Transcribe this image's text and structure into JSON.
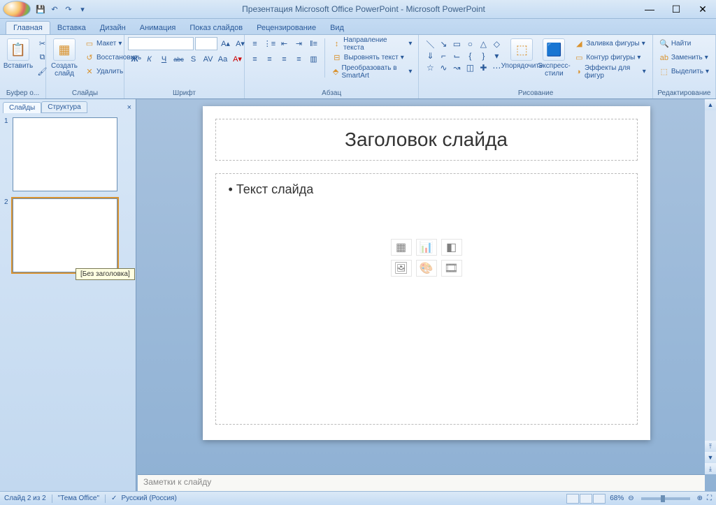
{
  "title": "Презентация Microsoft Office PowerPoint - Microsoft PowerPoint",
  "ribbon_tabs": [
    "Главная",
    "Вставка",
    "Дизайн",
    "Анимация",
    "Показ слайдов",
    "Рецензирование",
    "Вид"
  ],
  "ribbon": {
    "clipboard": {
      "paste": "Вставить",
      "label": "Буфер о..."
    },
    "slides": {
      "new": "Создать\nслайд",
      "layout": "Макет",
      "restore": "Восстановить",
      "delete": "Удалить",
      "label": "Слайды"
    },
    "font": {
      "label": "Шрифт",
      "bold": "Ж",
      "italic": "К",
      "underline": "Ч",
      "strike": "abc",
      "shadow": "S",
      "spacing": "AV",
      "case": "Aa",
      "grow": "A",
      "shrink": "A"
    },
    "paragraph": {
      "label": "Абзац",
      "text_dir": "Направление текста",
      "align_text": "Выровнять текст",
      "smartart": "Преобразовать в SmartArt"
    },
    "drawing": {
      "label": "Рисование",
      "arrange": "Упорядочить",
      "styles": "Экспресс-стили",
      "fill": "Заливка фигуры",
      "outline": "Контур фигуры",
      "effects": "Эффекты для фигур"
    },
    "editing": {
      "label": "Редактирование",
      "find": "Найти",
      "replace": "Заменить",
      "select": "Выделить"
    }
  },
  "panel": {
    "tab_slides": "Слайды",
    "tab_outline": "Структура",
    "tooltip": "[Без заголовка]",
    "thumbs": [
      "1",
      "2"
    ]
  },
  "slide": {
    "title": "Заголовок слайда",
    "body": "Текст слайда"
  },
  "notes": {
    "placeholder": "Заметки к слайду"
  },
  "status": {
    "slide": "Слайд 2 из 2",
    "theme": "\"Тема Office\"",
    "lang": "Русский (Россия)",
    "zoom": "68%"
  }
}
